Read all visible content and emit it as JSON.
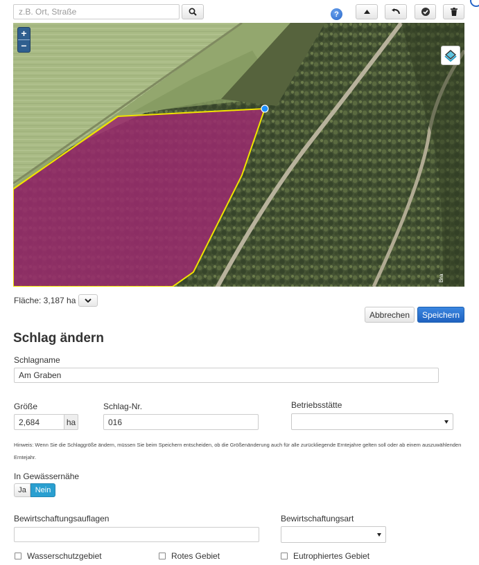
{
  "toolbar": {
    "search_placeholder": "z.B. Ort, Straße",
    "icons": [
      "search-icon",
      "help-icon",
      "arrow-up-icon",
      "undo-icon",
      "check-icon",
      "trash-icon"
    ]
  },
  "map": {
    "zoom_in": "+",
    "zoom_out": "−",
    "polygon_fill": "#9b2a6e",
    "polygon_stroke": "#f0e400",
    "vertex_color": "#1e90ff",
    "corner_text": "Bra"
  },
  "area": {
    "label": "Fläche: 3,187 ha"
  },
  "actions": {
    "cancel": "Abbrechen",
    "save": "Speichern"
  },
  "form": {
    "title": "Schlag ändern",
    "schlagname_label": "Schlagname",
    "schlagname_value": "Am Graben",
    "groesse_label": "Größe",
    "groesse_value": "2,684",
    "groesse_unit": "ha",
    "schlagnr_label": "Schlag-Nr.",
    "schlagnr_value": "016",
    "betriebsstaette_label": "Betriebsstätte",
    "betriebsstaette_value": "",
    "hint": "Hinweis: Wenn Sie die Schlaggröße ändern, müssen Sie beim Speichern entscheiden, ob die Größenänderung auch für alle zurückliegende Erntejahre gelten soll oder ab einem auszuwählenden Erntejahr.",
    "gewaesser_label": "In Gewässernähe",
    "gewaesser_options": [
      "Ja",
      "Nein"
    ],
    "gewaesser_selected": "Nein",
    "auflagen_label": "Bewirtschaftungsauflagen",
    "auflagen_value": "",
    "art_label": "Bewirtschaftungsart",
    "art_value": "",
    "checkboxes": [
      "Wasserschutzgebiet",
      "Rotes Gebiet",
      "Eutrophiertes Gebiet"
    ]
  },
  "colors": {
    "primary": "#1f62c0",
    "toggle_active": "#2a9fd0"
  }
}
